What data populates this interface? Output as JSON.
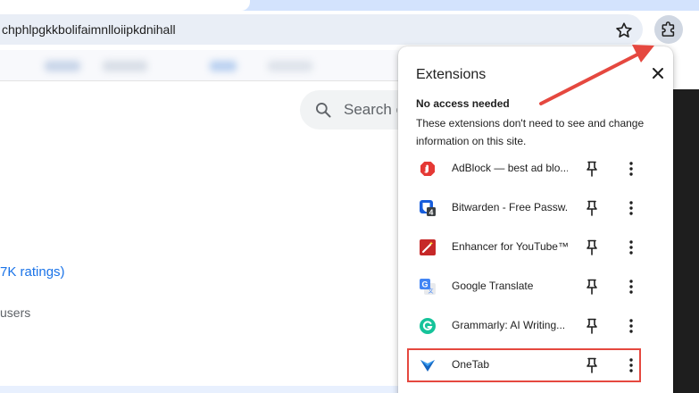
{
  "toolbar": {
    "url": "chphlpgkkbolifaimnlloiipkdnihall",
    "bookmark_icon": "star-icon",
    "extensions_icon": "puzzle-icon"
  },
  "page": {
    "search_placeholder": "Search e",
    "ratings_text": "7K ratings)",
    "users_text": "users"
  },
  "extensions_popup": {
    "title": "Extensions",
    "section_title": "No access needed",
    "section_description": "These extensions don't need to see and change information on this site.",
    "items": [
      {
        "name": "AdBlock — best ad blo...",
        "icon": "adblock-icon",
        "pinned": false
      },
      {
        "name": "Bitwarden - Free Passw...",
        "icon": "bitwarden-icon",
        "pinned": false
      },
      {
        "name": "Enhancer for YouTube™",
        "icon": "enhancer-icon",
        "pinned": false
      },
      {
        "name": "Google Translate",
        "icon": "google-translate-icon",
        "pinned": false
      },
      {
        "name": "Grammarly: AI Writing...",
        "icon": "grammarly-icon",
        "pinned": false
      },
      {
        "name": "OneTab",
        "icon": "onetab-icon",
        "pinned": false,
        "highlighted": true
      }
    ]
  },
  "colors": {
    "highlight": "#e5483f",
    "arrow": "#e5483f",
    "link": "#1a73e8"
  }
}
